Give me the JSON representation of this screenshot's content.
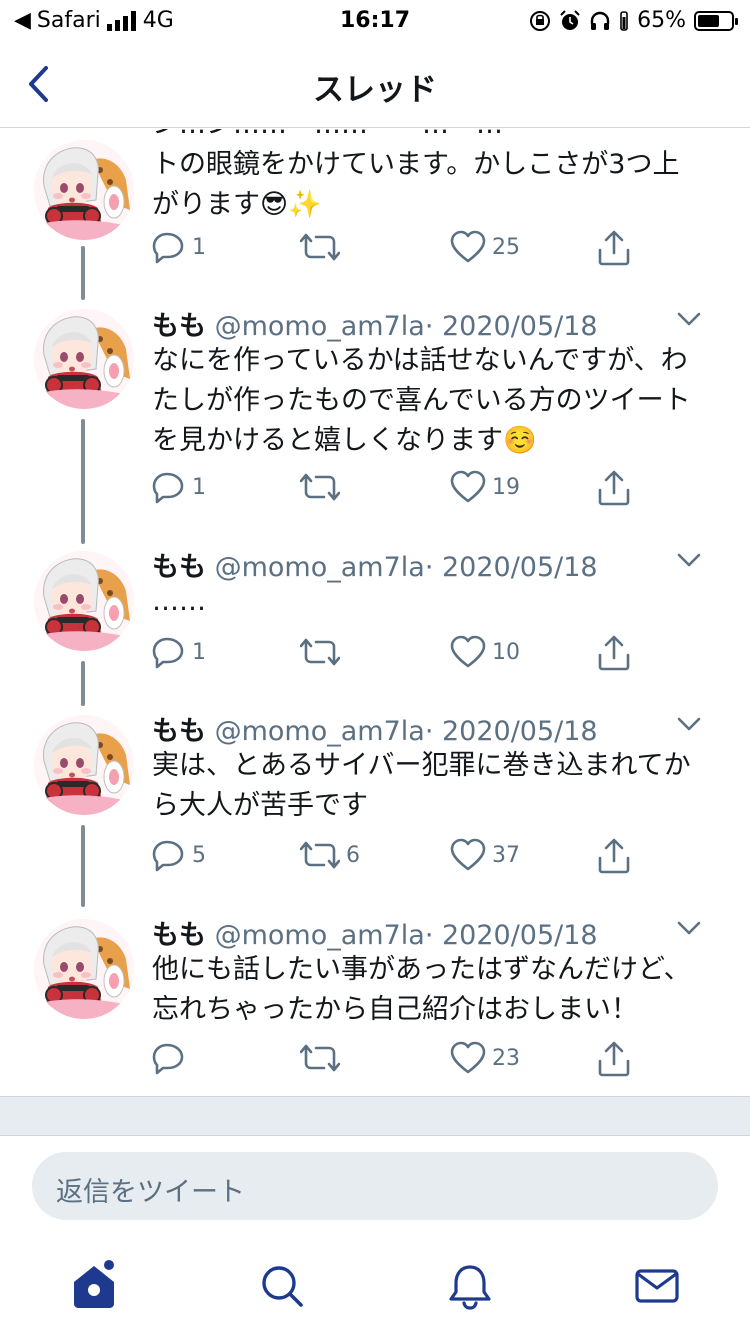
{
  "status_bar": {
    "carrier": "Safari",
    "network": "4G",
    "time": "16:17",
    "battery_percent": "65%",
    "battery_level": 0.65
  },
  "nav": {
    "title": "スレッド",
    "back_icon": "chevron-left-icon"
  },
  "colors": {
    "accent": "#1d3a8f",
    "secondary_text": "#5b7083",
    "thread_line": "#7f8b95"
  },
  "partial_tweet": {
    "body_line0": "ン…ン……ー……ーー…ー…ー",
    "body_line1": "トの眼鏡をかけています。かしこさが3つ上",
    "body_line2": "がります😎✨",
    "reply_count": "1",
    "retweet_count": "",
    "like_count": "25"
  },
  "tweets": [
    {
      "name": "もも",
      "handle": "@momo_am7la",
      "date": "· 2020/05/18",
      "body": [
        "なにを作っているかは話せないんですが、わ",
        "たしが作ったもので喜んでいる方のツイート",
        "を見かけると嬉しくなります☺️"
      ],
      "reply_count": "1",
      "retweet_count": "",
      "like_count": "19"
    },
    {
      "name": "もも",
      "handle": "@momo_am7la",
      "date": "· 2020/05/18",
      "body": [
        "……"
      ],
      "reply_count": "1",
      "retweet_count": "",
      "like_count": "10"
    },
    {
      "name": "もも",
      "handle": "@momo_am7la",
      "date": "· 2020/05/18",
      "body": [
        "実は、とあるサイバー犯罪に巻き込まれてか",
        "ら大人が苦手です"
      ],
      "reply_count": "5",
      "retweet_count": "6",
      "like_count": "37"
    },
    {
      "name": "もも",
      "handle": "@momo_am7la",
      "date": "· 2020/05/18",
      "body": [
        "他にも話したい事があったはずなんだけど、",
        "忘れちゃったから自己紹介はおしまい！"
      ],
      "reply_count": "",
      "retweet_count": "",
      "like_count": "23"
    }
  ],
  "reply": {
    "placeholder": "返信をツイート"
  },
  "tabs": [
    {
      "icon": "home-icon",
      "active": true
    },
    {
      "icon": "search-icon",
      "active": false
    },
    {
      "icon": "bell-icon",
      "active": false
    },
    {
      "icon": "mail-icon",
      "active": false
    }
  ]
}
